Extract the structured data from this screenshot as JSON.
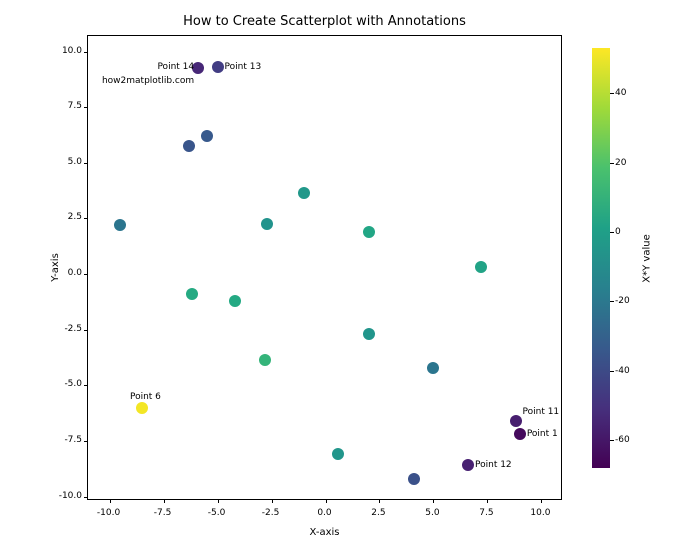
{
  "chart_data": {
    "type": "scatter",
    "title": "How to Create Scatterplot with Annotations",
    "xlabel": "X-axis",
    "ylabel": "Y-axis",
    "xlim": [
      -11,
      11
    ],
    "ylim": [
      -10.2,
      10.7
    ],
    "xticks": [
      -10,
      -7.5,
      -5,
      -2.5,
      0,
      2.5,
      5,
      7.5,
      10
    ],
    "yticks": [
      -10,
      -7.5,
      -5,
      -2.5,
      0,
      2.5,
      5,
      7.5,
      10
    ],
    "colorbar": {
      "label": "X*Y value",
      "ticks": [
        -60,
        -40,
        -20,
        0,
        20,
        40
      ],
      "min": -68,
      "max": 53
    },
    "points": [
      {
        "x": 9.0,
        "y": -7.2,
        "c": -64.8
      },
      {
        "x": -9.5,
        "y": 2.2,
        "c": -20.9
      },
      {
        "x": 7.2,
        "y": 0.3,
        "c": 2.2
      },
      {
        "x": 2.0,
        "y": -2.7,
        "c": -5.4
      },
      {
        "x": 4.1,
        "y": -9.2,
        "c": -37.7
      },
      {
        "x": -8.5,
        "y": -6.0,
        "c": 51.0
      },
      {
        "x": -4.2,
        "y": -1.2,
        "c": 5.0
      },
      {
        "x": 2.0,
        "y": 1.9,
        "c": 3.8
      },
      {
        "x": -2.7,
        "y": 2.25,
        "c": -6.1
      },
      {
        "x": -6.2,
        "y": -0.9,
        "c": 5.6
      },
      {
        "x": 8.8,
        "y": -6.6,
        "c": -58.1
      },
      {
        "x": 6.6,
        "y": -8.6,
        "c": -56.8
      },
      {
        "x": -5.0,
        "y": 9.3,
        "c": -46.5
      },
      {
        "x": -5.9,
        "y": 9.25,
        "c": -54.6
      },
      {
        "x": 0.6,
        "y": -8.1,
        "c": -4.9
      },
      {
        "x": -6.3,
        "y": 5.75,
        "c": -36.2
      },
      {
        "x": 5.0,
        "y": -4.2,
        "c": -21.0
      },
      {
        "x": -2.8,
        "y": -3.85,
        "c": 10.8
      },
      {
        "x": -5.5,
        "y": 6.2,
        "c": -34.1
      },
      {
        "x": -1.0,
        "y": 3.65,
        "c": -3.7
      }
    ],
    "annotations": [
      {
        "text": "Point 14",
        "x": -5.9,
        "y": 9.25,
        "anchor": "right"
      },
      {
        "text": "Point 13",
        "x": -5.0,
        "y": 9.3,
        "anchor": "left"
      },
      {
        "text": "how2matplotlib.com",
        "x": -5.9,
        "y": 8.65,
        "anchor": "right"
      },
      {
        "text": "Point 6",
        "x": -8.5,
        "y": -6.0,
        "anchor": "left-half"
      },
      {
        "text": "Point 11",
        "x": 8.8,
        "y": -6.6,
        "anchor": "left-high"
      },
      {
        "text": "Point 1",
        "x": 9.0,
        "y": -7.2,
        "anchor": "left"
      },
      {
        "text": "Point 12",
        "x": 6.6,
        "y": -8.6,
        "anchor": "left"
      }
    ]
  }
}
